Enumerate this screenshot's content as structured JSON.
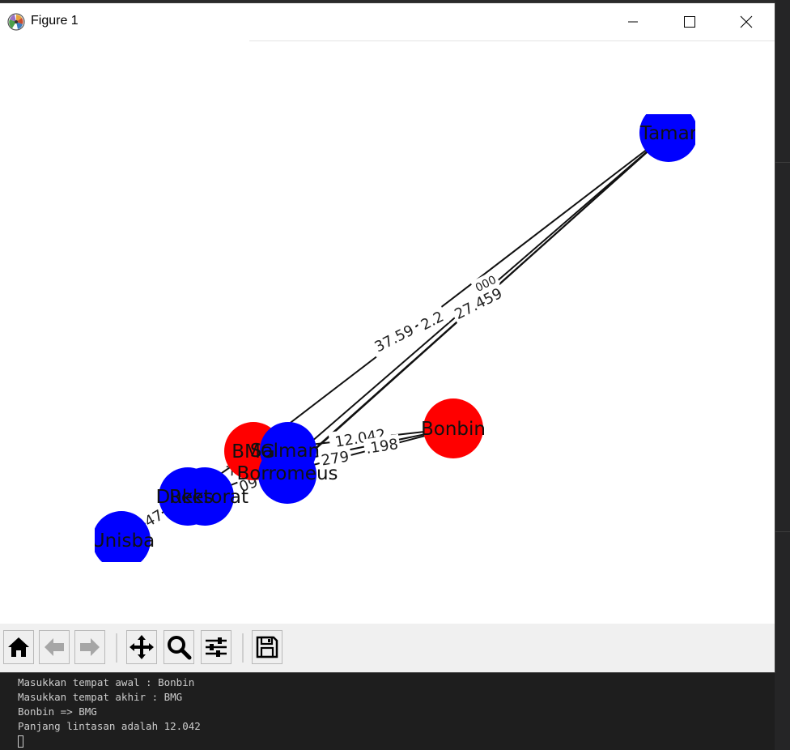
{
  "window": {
    "title": "Figure 1"
  },
  "graph": {
    "nodes": [
      {
        "label": "Tamar",
        "color": "#0000ff"
      },
      {
        "label": "Bonbin",
        "color": "#ff0000"
      },
      {
        "label": "BMG",
        "color": "#ff0000"
      },
      {
        "label": "Salman",
        "color": "#0000ff"
      },
      {
        "label": "Borromeus",
        "color": "#0000ff"
      },
      {
        "label": "Rektorat",
        "color": "#0000ff"
      },
      {
        "label": "Dukes",
        "color": "#0000ff"
      },
      {
        "label": "Unisba",
        "color": "#0000ff"
      }
    ],
    "edge_labels": [
      "37.59",
      "2.2",
      "27.459",
      "12.042",
      "279",
      ".198",
      "47",
      "09",
      "7",
      "000"
    ]
  },
  "toolbar": {
    "home": "home-icon",
    "back": "back-arrow-icon",
    "forward": "forward-arrow-icon",
    "pan": "pan-icon",
    "zoom": "zoom-icon",
    "configure": "configure-icon",
    "save": "save-icon"
  },
  "terminal": {
    "lines": [
      "Masukkan tempat awal : Bonbin",
      "Masukkan tempat akhir : BMG",
      "Bonbin => BMG",
      "Panjang lintasan adalah 12.042"
    ]
  }
}
